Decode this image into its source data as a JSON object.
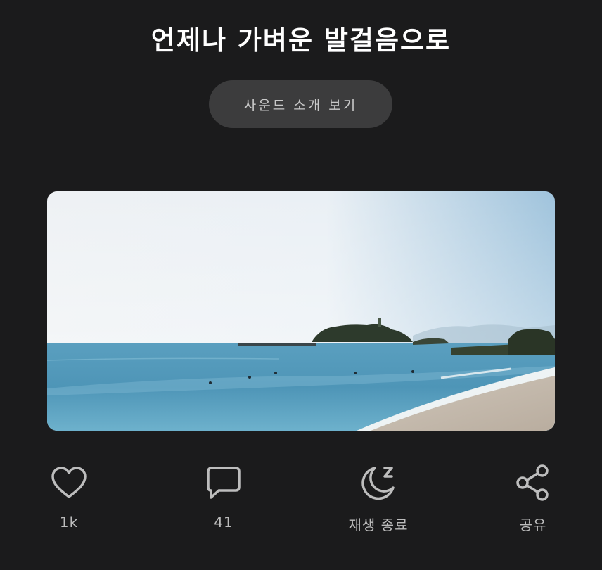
{
  "header": {
    "title": "언제나 가벼운 발걸음으로"
  },
  "sound_intro_button": {
    "label": "사운드 소개 보기"
  },
  "actions": {
    "like": {
      "icon": "heart-icon",
      "count": "1k"
    },
    "comment": {
      "icon": "comment-icon",
      "count": "41"
    },
    "sleep_timer": {
      "icon": "moon-sleep-icon",
      "label": "재생 종료"
    },
    "share": {
      "icon": "share-icon",
      "label": "공유"
    }
  },
  "colors": {
    "background": "#1b1b1c",
    "button_bg": "#3c3c3d",
    "icon": "#bdbdbd"
  }
}
